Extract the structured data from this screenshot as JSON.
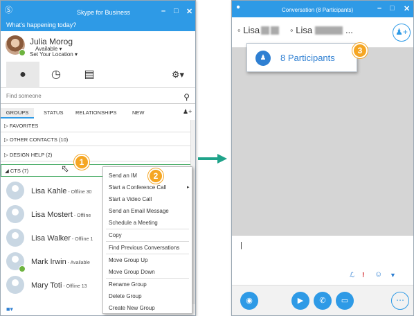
{
  "left_window": {
    "title": "Skype for Business",
    "whats_happening": "What's happening today?",
    "user": {
      "name": "Julia Morog",
      "status": "Available ▾",
      "location": "Set Your Location ▾"
    },
    "search_placeholder": "Find someone",
    "group_tabs": [
      "GROUPS",
      "STATUS",
      "RELATIONSHIPS",
      "NEW"
    ],
    "groups": [
      "FAVORITES",
      "OTHER CONTACTS (10)",
      "DESIGN HELP (2)",
      "CTS (7)"
    ],
    "contacts": [
      {
        "name": "Lisa Kahle",
        "status": " - Offline 30"
      },
      {
        "name": "Lisa Mostert",
        "status": " - Offline"
      },
      {
        "name": "Lisa Walker",
        "status": " - Offline 1"
      },
      {
        "name": "Mark Irwin",
        "status": " - Available"
      },
      {
        "name": "Mary Toti",
        "status": " - Offline 13"
      }
    ]
  },
  "context_menu": [
    "Send an IM",
    "Start a Conference Call",
    "Start a Video Call",
    "Send an Email Message",
    "Schedule a Meeting",
    "Copy",
    "Find Previous Conversations",
    "Move Group Up",
    "Move Group Down",
    "Rename Group",
    "Delete Group",
    "Create New Group"
  ],
  "badges": [
    "1",
    "2",
    "3"
  ],
  "right_window": {
    "title": "Conversation (8 Participants)",
    "participant_1": "Lisa",
    "participant_2": "Lisa",
    "ellipsis": "...",
    "participants_popup": "8 Participants",
    "compose_cursor": "|"
  },
  "colors": {
    "accent": "#2e9ae6",
    "badge": "#f5a623",
    "highlight": "#3fa85f",
    "arrow": "#1fa38a"
  }
}
